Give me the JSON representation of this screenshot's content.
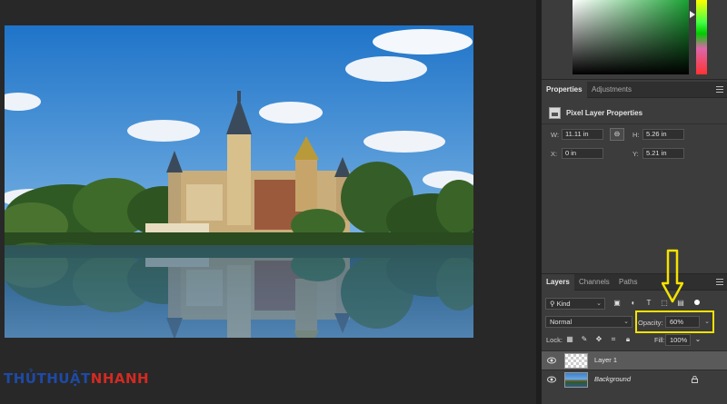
{
  "colors": {
    "highlight": "#f4e200",
    "panel_bg": "#3c3c3c",
    "app_bg": "#282828"
  },
  "watermark": {
    "part1": "THỦTHUẬT",
    "part2": "NHANH"
  },
  "properties_panel": {
    "tabs": [
      "Properties",
      "Adjustments"
    ],
    "title": "Pixel Layer Properties",
    "w_label": "W:",
    "w_value": "11.11 in",
    "h_label": "H:",
    "h_value": "5.26 in",
    "x_label": "X:",
    "x_value": "0 in",
    "y_label": "Y:",
    "y_value": "5.21 in",
    "link_icon": "link-icon"
  },
  "layers_panel": {
    "tabs": [
      "Layers",
      "Channels",
      "Paths"
    ],
    "filter_label": "Kind",
    "blend_mode": "Normal",
    "opacity_label": "Opacity:",
    "opacity_value": "60%",
    "lock_label": "Lock:",
    "fill_label": "Fill:",
    "fill_value": "100%",
    "layers": [
      {
        "name": "Layer 1",
        "selected": true,
        "visible": true
      },
      {
        "name": "Background",
        "selected": false,
        "visible": true,
        "locked": true
      }
    ]
  }
}
